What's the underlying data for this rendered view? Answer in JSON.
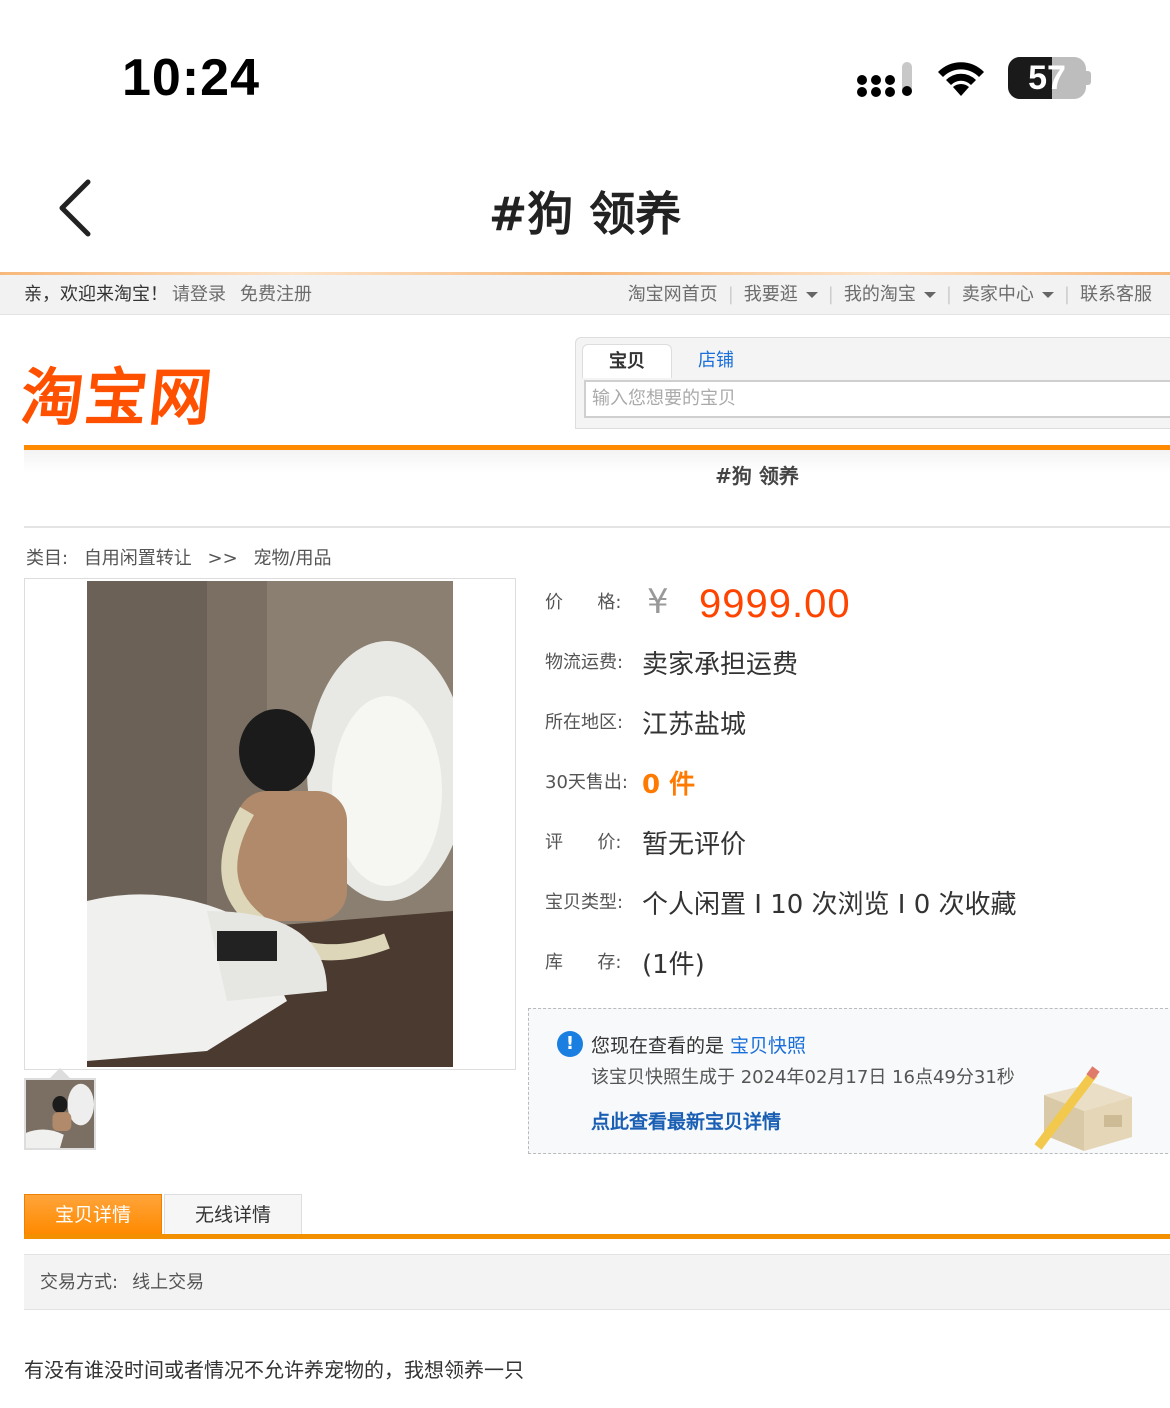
{
  "status_bar": {
    "time": "10:24",
    "battery_level": "57",
    "battery_fraction": 0.57
  },
  "header": {
    "title": "#狗 领养"
  },
  "site_nav": {
    "welcome": "亲，欢迎来淘宝！",
    "login": "请登录",
    "register": "免费注册",
    "links": [
      "淘宝网首页",
      "我要逛",
      "我的淘宝",
      "卖家中心",
      "联系客服"
    ]
  },
  "logo": {
    "text": "淘宝网"
  },
  "search": {
    "tab_item": "宝贝",
    "tab_shop": "店铺",
    "placeholder": "输入您想要的宝贝"
  },
  "title_band": {
    "text": "#狗 领养"
  },
  "breadcrumb": {
    "label": "类目:",
    "category": "自用闲置转让",
    "separator": ">>",
    "subcategory": "宠物/用品"
  },
  "props": {
    "price_label": "价      格:",
    "currency": "¥",
    "price": "9999.00",
    "shipping_label": "物流运费:",
    "shipping": "卖家承担运费",
    "location_label": "所在地区:",
    "location": "江苏盐城",
    "sold_label": "30天售出:",
    "sold": "0 件",
    "rating_label": "评      价:",
    "rating": "暂无评价",
    "type_label": "宝贝类型:",
    "type": "个人闲置 I 10 次浏览 I 0 次收藏",
    "stock_label": "库      存:",
    "stock": "(1件)"
  },
  "snapshot": {
    "text": "您现在查看的是",
    "link": "宝贝快照",
    "generated": "该宝贝快照生成于 2024年02月17日 16点49分31秒",
    "latest_link": "点此查看最新宝贝详情"
  },
  "tabs": {
    "details": "宝贝详情",
    "wireless": "无线详情"
  },
  "trade": {
    "label": "交易方式:",
    "value": "线上交易"
  },
  "description": "有没有谁没时间或者情况不允许养宠物的，我想领养一只",
  "colors": {
    "accent": "#ff8a00",
    "price": "#ff4400",
    "link": "#1a6fd9",
    "logo": "#ff5000"
  }
}
